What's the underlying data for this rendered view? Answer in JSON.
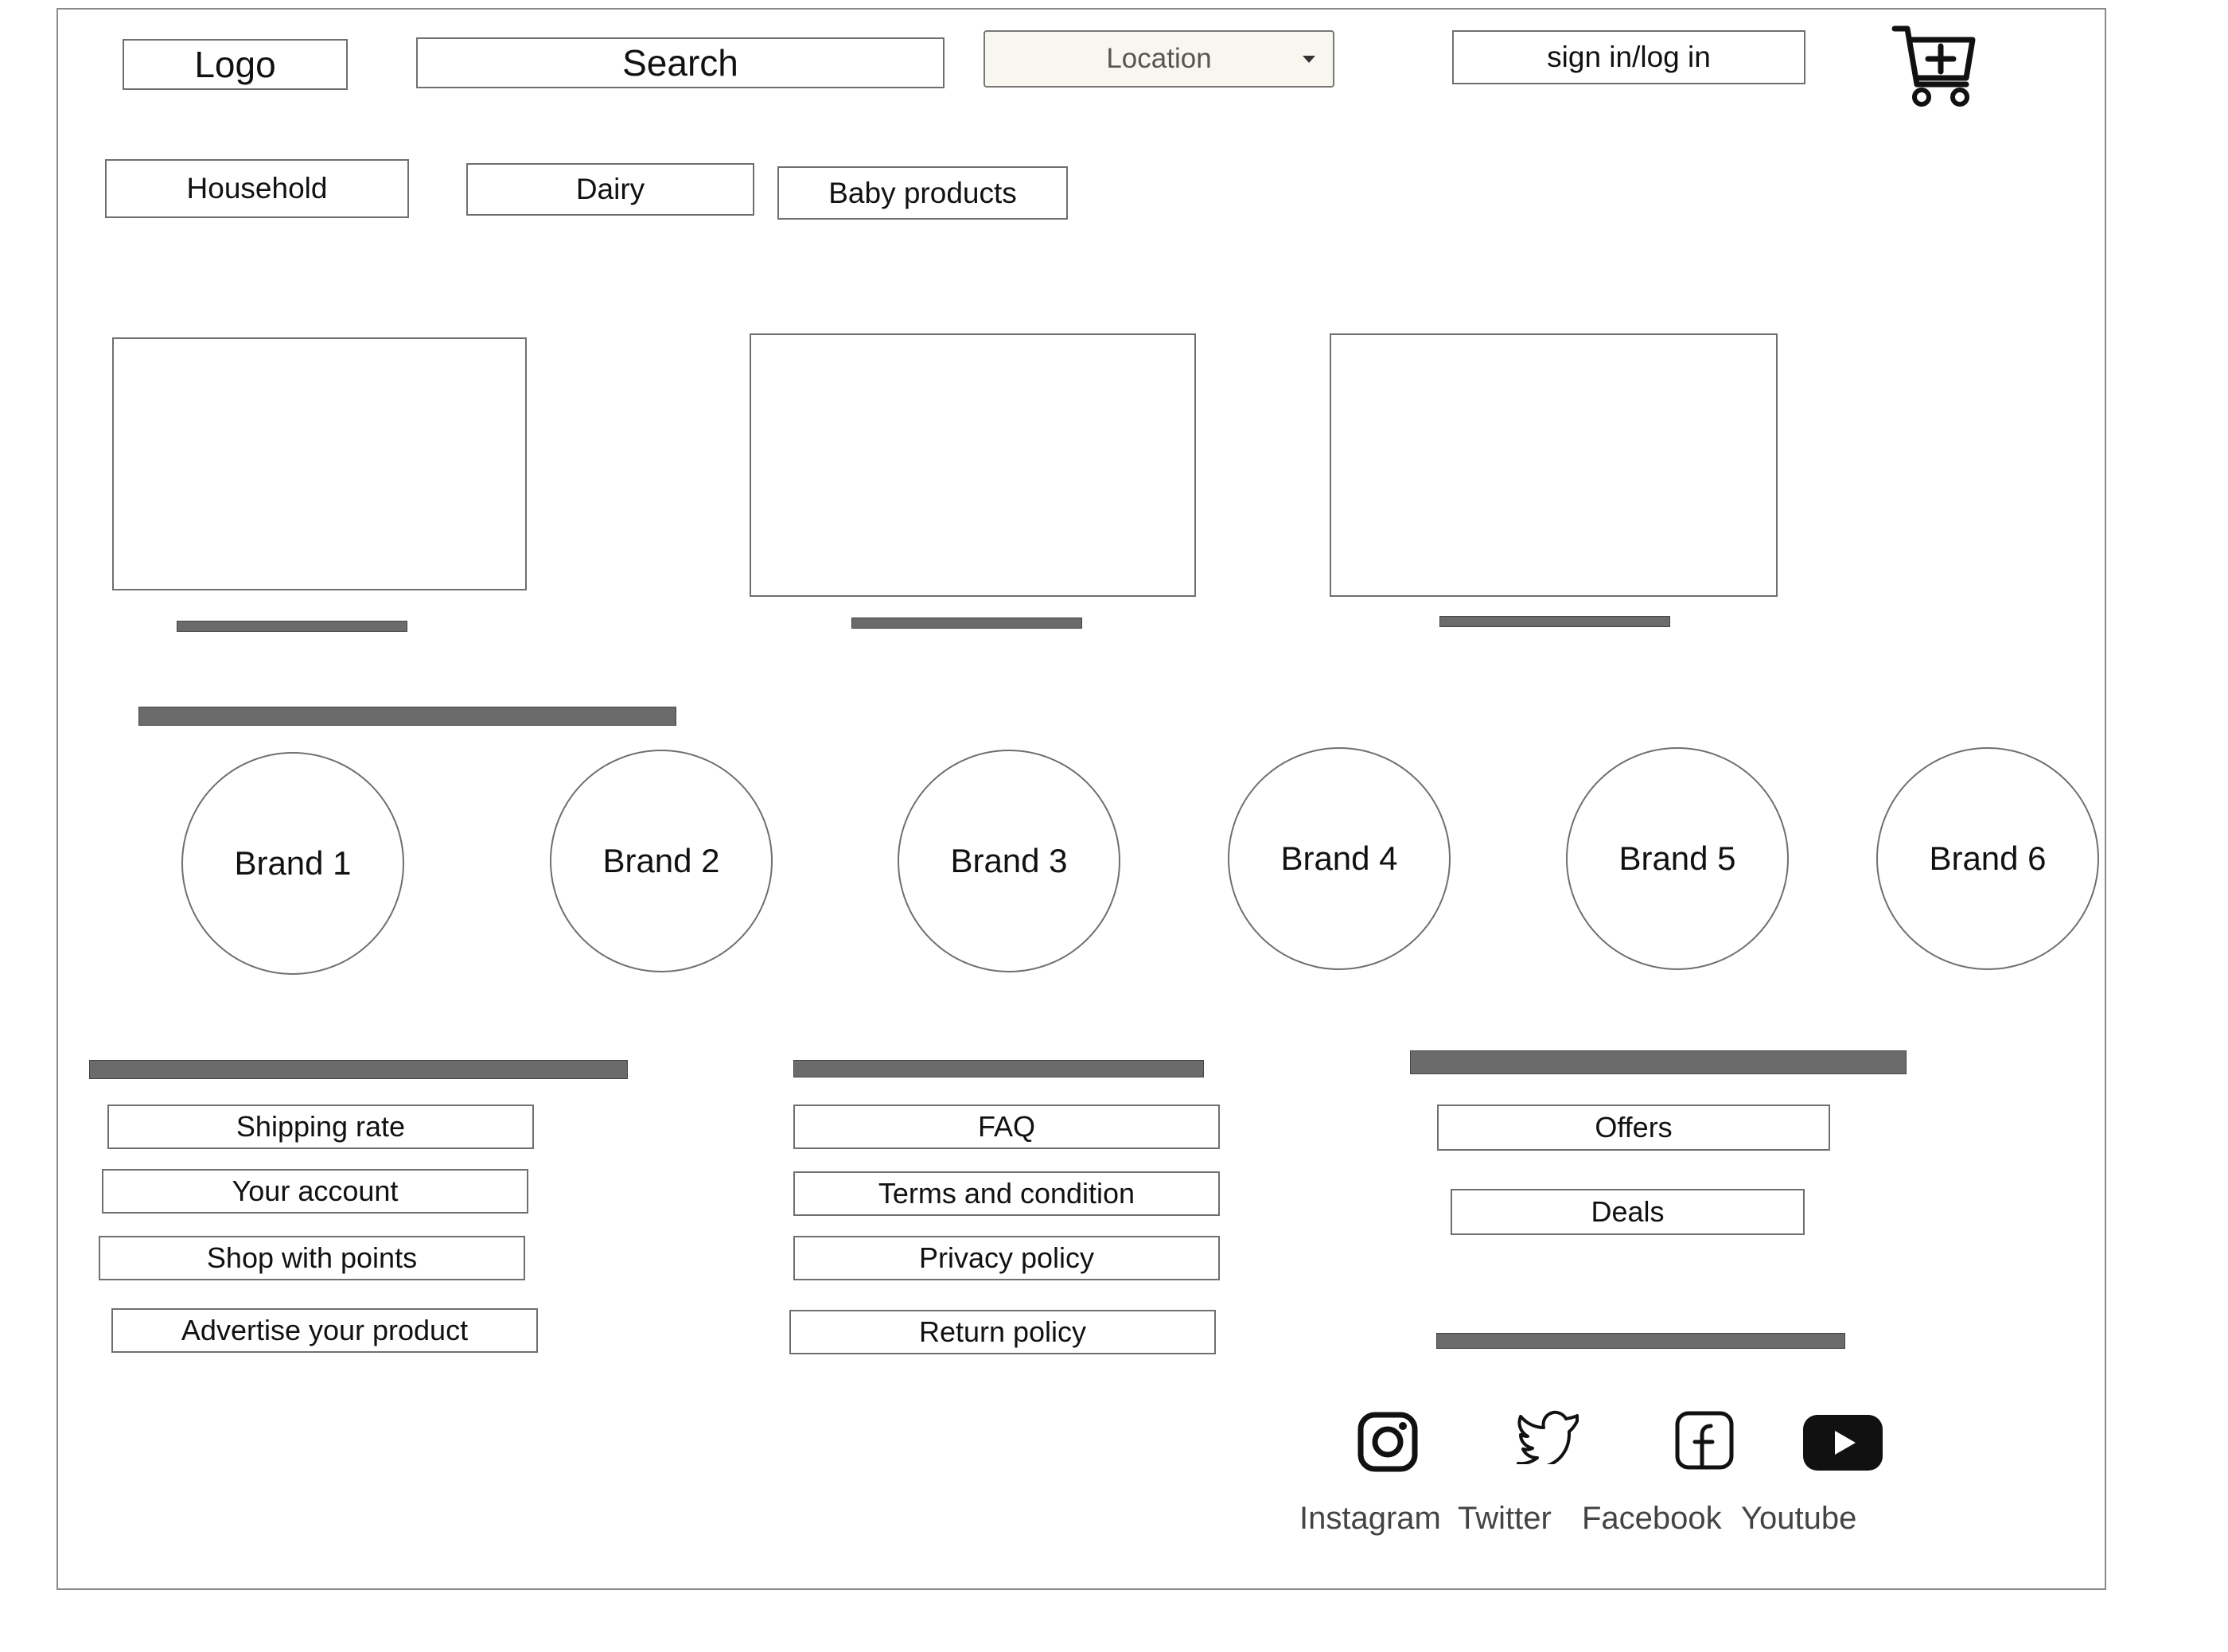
{
  "header": {
    "logo_label": "Logo",
    "search_label": "Search",
    "location_label": "Location",
    "signin_label": "sign in/log in",
    "cart_icon": "cart-plus-icon"
  },
  "categories": [
    "Household",
    "Dairy",
    "Baby products"
  ],
  "brands": [
    "Brand 1",
    "Brand 2",
    "Brand 3",
    "Brand 4",
    "Brand 5",
    "Brand 6"
  ],
  "footer": {
    "col1": [
      "Shipping rate",
      "Your account",
      "Shop with points",
      "Advertise your product"
    ],
    "col2": [
      "FAQ",
      "Terms and condition",
      "Privacy policy",
      "Return policy"
    ],
    "col3": [
      "Offers",
      "Deals"
    ],
    "social": [
      {
        "label": "Instagram",
        "icon": "instagram-icon"
      },
      {
        "label": "Twitter",
        "icon": "twitter-icon"
      },
      {
        "label": "Facebook",
        "icon": "facebook-icon"
      },
      {
        "label": "Youtube",
        "icon": "youtube-icon"
      }
    ]
  },
  "colors": {
    "border": "#6f6f6f",
    "placeholder_bar": "#6b6b6b",
    "location_bg": "#f8f6ee"
  }
}
